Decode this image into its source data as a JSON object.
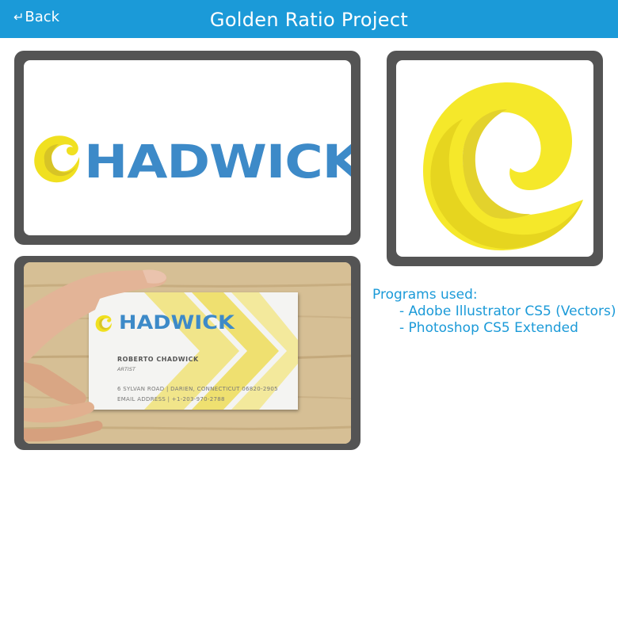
{
  "header": {
    "back_label": "Back",
    "title": "Golden Ratio Project"
  },
  "logo": {
    "wordmark": "HADWICK",
    "brand_blue": "#3d8ac8",
    "brand_yellow": "#f0e020"
  },
  "business_card": {
    "wordmark": "HADWICK",
    "name": "ROBERTO CHADWICK",
    "role": "ARTIST",
    "address": "6 SYLVAN ROAD | DARIEN, CONNECTICUT 06820-2905",
    "email_line": "EMAIL ADDRESS | +1-203-970-2788"
  },
  "programs": {
    "heading": "Programs used:",
    "items": [
      "- Adobe Illustrator CS5 (Vectors)",
      "- Photoshop CS5 Extended"
    ]
  },
  "colors": {
    "header_bg": "#1b9ad8",
    "frame": "#545454",
    "text_accent": "#1b9ad8"
  }
}
